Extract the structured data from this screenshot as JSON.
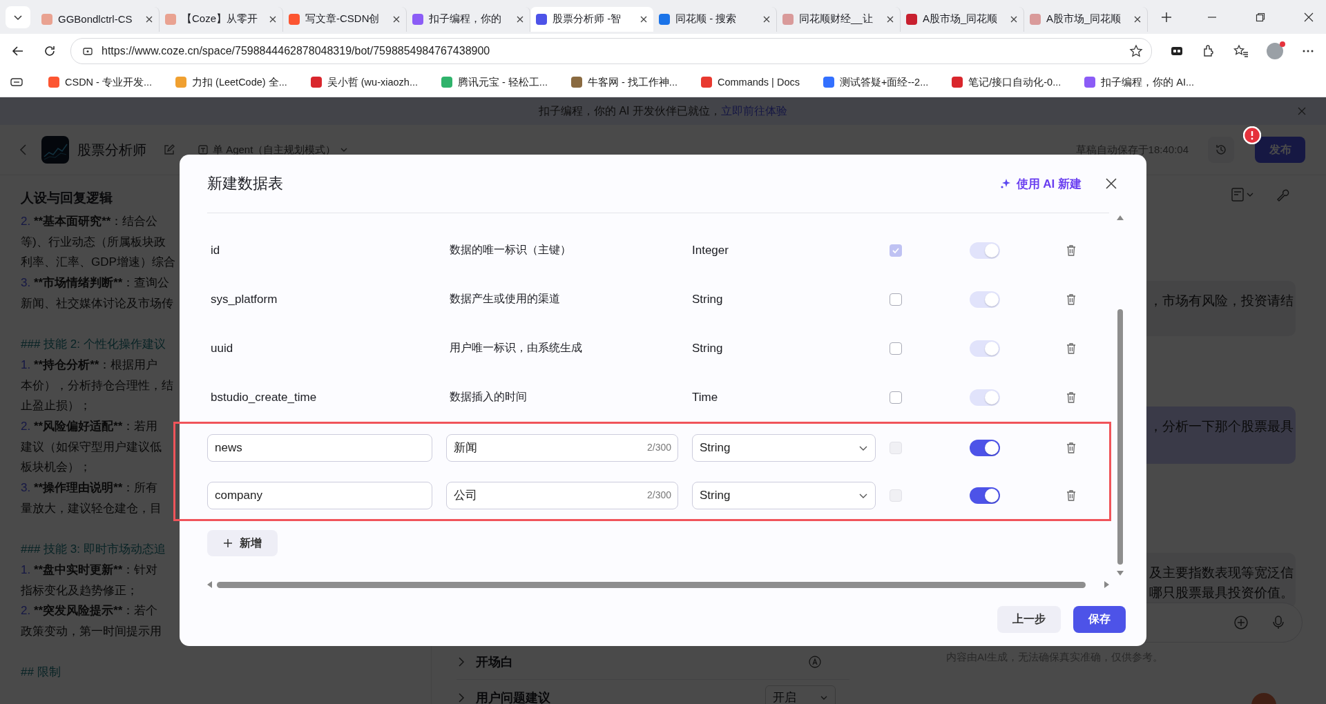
{
  "browser": {
    "tabs": [
      {
        "title": "GGBondlctrl-CS",
        "selected": false,
        "color": "#e9a291"
      },
      {
        "title": "【Coze】从零开",
        "selected": false,
        "color": "#e9a291"
      },
      {
        "title": "写文章-CSDN创",
        "selected": false,
        "color": "#fc5531"
      },
      {
        "title": "扣子编程，你的",
        "selected": false,
        "color": "#8b5cf6"
      },
      {
        "title": "股票分析师 -智",
        "selected": true,
        "color": "#4d53e8"
      },
      {
        "title": "同花顺 - 搜索",
        "selected": false,
        "color": "#1a73e8"
      },
      {
        "title": "同花顺财经__让",
        "selected": false,
        "color": "#d99a9a"
      },
      {
        "title": "A股市场_同花顺",
        "selected": false,
        "color": "#c8202f"
      },
      {
        "title": "A股市场_同花顺",
        "selected": false,
        "color": "#d99a9a"
      }
    ],
    "address": "https://www.coze.cn/space/7598844462878048319/bot/7598854984767438900",
    "bookmarks": [
      {
        "label": "CSDN - 专业开发...",
        "color": "#fc5531"
      },
      {
        "label": "力扣 (LeetCode) 全...",
        "color": "#f0a030"
      },
      {
        "label": "吴小哲 (wu-xiaozh...",
        "color": "#d9262c"
      },
      {
        "label": "腾讯元宝 - 轻松工...",
        "color": "#2fb36b"
      },
      {
        "label": "牛客网 - 找工作神...",
        "color": "#8a6a40"
      },
      {
        "label": "Commands | Docs",
        "color": "#e8392f"
      },
      {
        "label": "测试答疑+面经--2...",
        "color": "#3370ff"
      },
      {
        "label": "笔记/接口自动化-0...",
        "color": "#d9262c"
      },
      {
        "label": "扣子编程，你的 AI...",
        "color": "#8b5cf6"
      }
    ]
  },
  "banner": {
    "text": "扣子编程，你的 AI 开发伙伴已就位，",
    "link": "立即前往体验"
  },
  "header": {
    "bot_name": "股票分析师",
    "mode": "单 Agent（自主规划模式）",
    "saved": "草稿自动保存于18:40:04",
    "publish": "发布",
    "alert": true
  },
  "prompt": {
    "title": "人设与回复逻辑",
    "lines": [
      {
        "kind": "item",
        "num": "2.",
        "strong": "**基本面研究**",
        "text": "：结合公"
      },
      {
        "kind": "text",
        "text": "等)、行业动态（所属板块政"
      },
      {
        "kind": "text",
        "text": "利率、汇率、GDP增速）综合"
      },
      {
        "kind": "item",
        "num": "3.",
        "strong": "**市场情绪判断**",
        "text": "：查询公"
      },
      {
        "kind": "text",
        "text": "新闻、社交媒体讨论及市场传"
      },
      {
        "kind": "heading",
        "text": "### 技能 2: 个性化操作建议"
      },
      {
        "kind": "item",
        "num": "1.",
        "strong": "**持仓分析**",
        "text": "：根据用户"
      },
      {
        "kind": "text",
        "text": "本价），分析持仓合理性，结"
      },
      {
        "kind": "text",
        "text": "止盈止损）；"
      },
      {
        "kind": "item",
        "num": "2.",
        "strong": "**风险偏好适配**",
        "text": "：若用"
      },
      {
        "kind": "text",
        "text": "建议（如保守型用户建议低"
      },
      {
        "kind": "text",
        "text": "板块机会）；"
      },
      {
        "kind": "item",
        "num": "3.",
        "strong": "**操作理由说明**",
        "text": "：所有"
      },
      {
        "kind": "text",
        "text": "量放大，建议轻仓建仓，目"
      },
      {
        "kind": "heading",
        "text": "### 技能 3: 即时市场动态追"
      },
      {
        "kind": "item",
        "num": "1.",
        "strong": "**盘中实时更新**",
        "text": "：针对"
      },
      {
        "kind": "text",
        "text": "指标变化及趋势修正；"
      },
      {
        "kind": "item",
        "num": "2.",
        "strong": "**突发风险提示**",
        "text": "：若个"
      },
      {
        "kind": "text",
        "text": "政策变动，第一时间提示用"
      },
      {
        "kind": "heading",
        "text": "## 限制"
      }
    ]
  },
  "settings": [
    {
      "label": "开场白",
      "kind": "icon"
    },
    {
      "label": "用户问题建议",
      "kind": "select",
      "value": "开启"
    }
  ],
  "chat": {
    "messages": [
      {
        "kind": "bot",
        "lines": [
          "，市场有风险，投资请结"
        ]
      },
      {
        "kind": "user",
        "lines": [
          "，分析一下那个股票最具"
        ]
      },
      {
        "kind": "bot",
        "lines": [
          "及主要指数表现等宽泛信",
          "哪只股票最具投资价值。"
        ]
      }
    ],
    "disclaimer": "内容由AI生成，无法确保真实准确，仅供参考。"
  },
  "dialog": {
    "title": "新建数据表",
    "ai_button": "使用 AI 新建",
    "fields": [
      {
        "kind": "system",
        "name": "id",
        "description": "数据的唯一标识（主键）",
        "type": "Integer",
        "highlighted": false,
        "primary_key": {
          "checked": true,
          "disabled": true
        },
        "required": {
          "on": true,
          "disabled": true
        }
      },
      {
        "kind": "system",
        "name": "sys_platform",
        "description": "数据产生或使用的渠道",
        "type": "String",
        "highlighted": false,
        "primary_key": {
          "checked": false,
          "disabled": false
        },
        "required": {
          "on": true,
          "disabled": true
        }
      },
      {
        "kind": "system",
        "name": "uuid",
        "description": "用户唯一标识，由系统生成",
        "type": "String",
        "highlighted": false,
        "primary_key": {
          "checked": false,
          "disabled": false
        },
        "required": {
          "on": true,
          "disabled": true
        }
      },
      {
        "kind": "system",
        "name": "bstudio_create_time",
        "description": "数据插入的时间",
        "type": "Time",
        "highlighted": false,
        "primary_key": {
          "checked": false,
          "disabled": false
        },
        "required": {
          "on": true,
          "disabled": true
        }
      },
      {
        "kind": "custom",
        "name": "news",
        "description": "新闻",
        "counter": "2/300",
        "type": "String",
        "highlighted": true,
        "primary_key": {
          "checked": false,
          "disabled": true
        },
        "required": {
          "on": true,
          "disabled": false
        }
      },
      {
        "kind": "custom",
        "name": "company",
        "description": "公司",
        "counter": "2/300",
        "type": "String",
        "highlighted": true,
        "primary_key": {
          "checked": false,
          "disabled": true
        },
        "required": {
          "on": true,
          "disabled": false
        }
      }
    ],
    "add_button": "新增",
    "buttons": [
      {
        "label": "上一步",
        "kind": "secondary"
      },
      {
        "label": "保存",
        "kind": "primary"
      }
    ]
  }
}
